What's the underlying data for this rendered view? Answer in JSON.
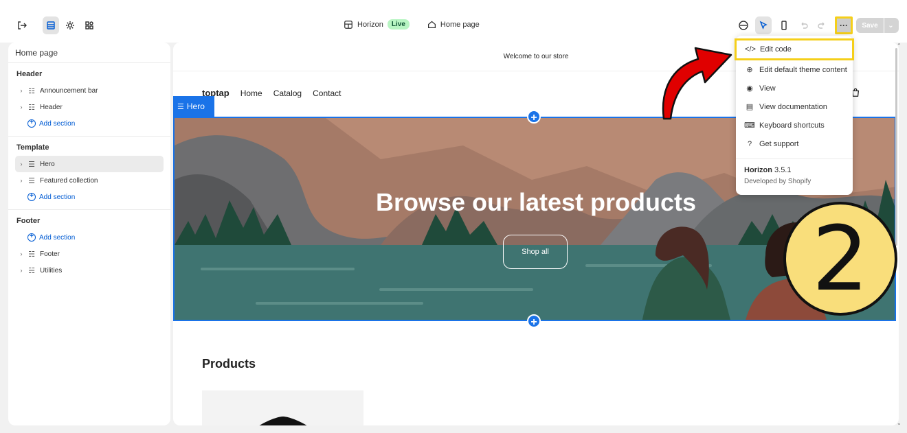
{
  "topbar": {
    "theme_name": "Horizon",
    "live_label": "Live",
    "page_name": "Home page",
    "more_label": "···",
    "save_label": "Save",
    "save_chevron": "⌄"
  },
  "sidebar": {
    "title": "Home page",
    "groups": [
      {
        "title": "Header",
        "items": [
          "Announcement bar",
          "Header"
        ],
        "add_label": "Add section"
      },
      {
        "title": "Template",
        "items": [
          "Hero",
          "Featured collection"
        ],
        "add_label": "Add section"
      },
      {
        "title": "Footer",
        "add_label": "Add section",
        "items": [
          "Footer",
          "Utilities"
        ]
      }
    ]
  },
  "preview": {
    "announcement": "Welcome to our store",
    "logo": "toptap",
    "nav_links": [
      "Home",
      "Catalog",
      "Contact"
    ],
    "hero_tag": "Hero",
    "hero_heading": "Browse our latest products",
    "hero_button": "Shop all",
    "products_title": "Products"
  },
  "menu": {
    "items": [
      {
        "label": "Edit code",
        "icon": "code-icon"
      },
      {
        "label": "Edit default theme content",
        "icon": "globe-icon"
      },
      {
        "label": "View",
        "icon": "eye-icon"
      },
      {
        "label": "View documentation",
        "icon": "book-icon"
      },
      {
        "label": "Keyboard shortcuts",
        "icon": "keyboard-icon"
      },
      {
        "label": "Get support",
        "icon": "question-icon"
      }
    ],
    "theme_name": "Horizon",
    "theme_version": "3.5.1",
    "developer": "Developed by Shopify"
  },
  "annotation": {
    "step_number": "2"
  },
  "colors": {
    "accent": "#005bd3",
    "highlight": "#f5cf1a",
    "hero_selection": "#1a73e8",
    "arrow": "#e00000"
  }
}
